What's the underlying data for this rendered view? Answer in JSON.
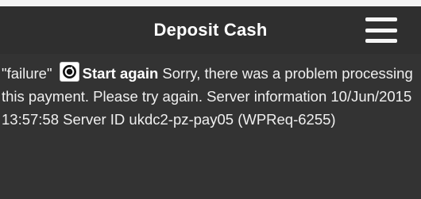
{
  "header": {
    "title": "Deposit Cash",
    "menu_icon": "hamburger-menu-icon"
  },
  "message": {
    "status": "\"failure\"",
    "retry_icon": "retry-icon",
    "start_again_label": "Start again",
    "body": "Sorry, there was a problem processing this payment. Please try again. Server information 10/Jun/2015 13:57:58 Server ID ukdc2-pz-pay05 (WPReq-6255)"
  },
  "colors": {
    "header_bg": "#2f2f2f",
    "content_bg": "#333333",
    "text": "#f0f0f0"
  }
}
